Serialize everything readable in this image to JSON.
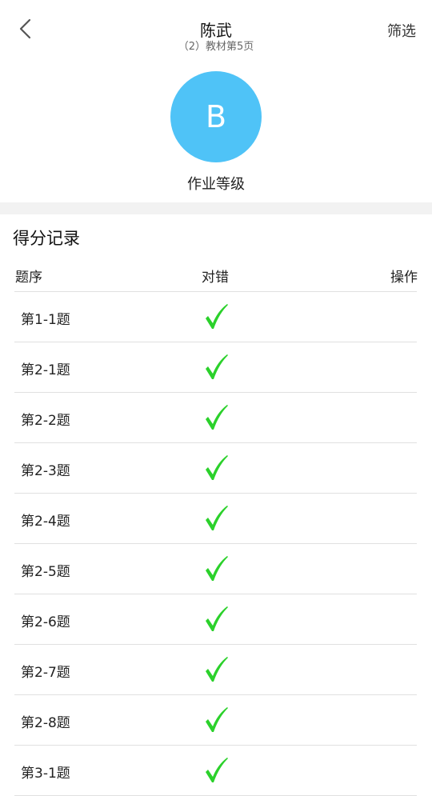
{
  "header": {
    "title": "陈武",
    "subtitle": "（2）教材第5页",
    "filter_label": "筛选"
  },
  "grade": {
    "letter": "B",
    "label": "作业等级",
    "color": "#4fc3f7"
  },
  "record": {
    "title": "得分记录",
    "columns": {
      "no": "题序",
      "result": "对错",
      "action": "操作"
    },
    "rows": [
      {
        "label": "第1-1题",
        "result": "correct"
      },
      {
        "label": "第2-1题",
        "result": "correct"
      },
      {
        "label": "第2-2题",
        "result": "correct"
      },
      {
        "label": "第2-3题",
        "result": "correct"
      },
      {
        "label": "第2-4题",
        "result": "correct"
      },
      {
        "label": "第2-5题",
        "result": "correct"
      },
      {
        "label": "第2-6题",
        "result": "correct"
      },
      {
        "label": "第2-7题",
        "result": "correct"
      },
      {
        "label": "第2-8题",
        "result": "correct"
      },
      {
        "label": "第3-1题",
        "result": "correct"
      }
    ]
  },
  "colors": {
    "check": "#2bd12b",
    "divider": "#e0e0e0",
    "band": "#f2f2f2"
  },
  "icons": {
    "back": "chevron-left-icon",
    "correct": "checkmark-icon"
  }
}
